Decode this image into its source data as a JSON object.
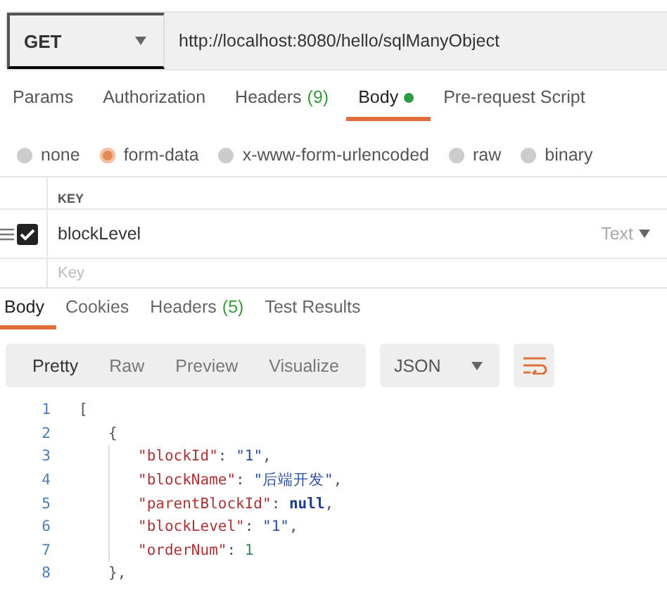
{
  "request": {
    "method": "GET",
    "url": "http://localhost:8080/hello/sqlManyObject"
  },
  "request_tabs": [
    {
      "label": "Params",
      "selected": false
    },
    {
      "label": "Authorization",
      "selected": false
    },
    {
      "label": "Headers",
      "count": "(9)",
      "selected": false
    },
    {
      "label": "Body",
      "dot": true,
      "selected": true
    },
    {
      "label": "Pre-request Script",
      "selected": false
    }
  ],
  "body_types": [
    {
      "label": "none",
      "selected": false
    },
    {
      "label": "form-data",
      "selected": true
    },
    {
      "label": "x-www-form-urlencoded",
      "selected": false
    },
    {
      "label": "raw",
      "selected": false
    },
    {
      "label": "binary",
      "selected": false
    }
  ],
  "params_table": {
    "columns": [
      "KEY"
    ],
    "rows": [
      {
        "key": "blockLevel",
        "checked": true,
        "type": "Text"
      }
    ],
    "new_row": {
      "placeholder": "Key"
    }
  },
  "response_tabs": [
    {
      "label": "Body",
      "selected": true
    },
    {
      "label": "Cookies",
      "selected": false
    },
    {
      "label": "Headers",
      "count": "(5)",
      "selected": false
    },
    {
      "label": "Test Results",
      "selected": false
    }
  ],
  "view_modes": [
    {
      "label": "Pretty",
      "selected": true
    },
    {
      "label": "Raw",
      "selected": false
    },
    {
      "label": "Preview",
      "selected": false
    },
    {
      "label": "Visualize",
      "selected": false
    }
  ],
  "format": "JSON",
  "code": [
    {
      "number": "1",
      "tokens": [
        {
          "kind": "punct",
          "text": "["
        }
      ],
      "children": [
        {
          "number": "2",
          "tokens": [
            {
              "kind": "punct",
              "text": "{"
            }
          ],
          "children": [
            {
              "number": "3",
              "tokens": [
                {
                  "kind": "key",
                  "text": "\"blockId\""
                },
                {
                  "kind": "punct",
                  "text": ": "
                },
                {
                  "kind": "string",
                  "text": "\"1\""
                },
                {
                  "kind": "punct",
                  "text": ","
                }
              ]
            },
            {
              "number": "4",
              "tokens": [
                {
                  "kind": "key",
                  "text": "\"blockName\""
                },
                {
                  "kind": "punct",
                  "text": ": "
                },
                {
                  "kind": "string",
                  "text": "\"后端开发\""
                },
                {
                  "kind": "punct",
                  "text": ","
                }
              ]
            },
            {
              "number": "5",
              "tokens": [
                {
                  "kind": "key",
                  "text": "\"parentBlockId\""
                },
                {
                  "kind": "punct",
                  "text": ": "
                },
                {
                  "kind": "null",
                  "text": "null"
                },
                {
                  "kind": "punct",
                  "text": ","
                }
              ]
            },
            {
              "number": "6",
              "tokens": [
                {
                  "kind": "key",
                  "text": "\"blockLevel\""
                },
                {
                  "kind": "punct",
                  "text": ": "
                },
                {
                  "kind": "string",
                  "text": "\"1\""
                },
                {
                  "kind": "punct",
                  "text": ","
                }
              ]
            },
            {
              "number": "7",
              "tokens": [
                {
                  "kind": "key",
                  "text": "\"orderNum\""
                },
                {
                  "kind": "punct",
                  "text": ": "
                },
                {
                  "kind": "number",
                  "text": "1"
                }
              ]
            }
          ]
        },
        {
          "number": "8",
          "tokens": [
            {
              "kind": "punct",
              "text": "},"
            }
          ]
        }
      ]
    }
  ]
}
